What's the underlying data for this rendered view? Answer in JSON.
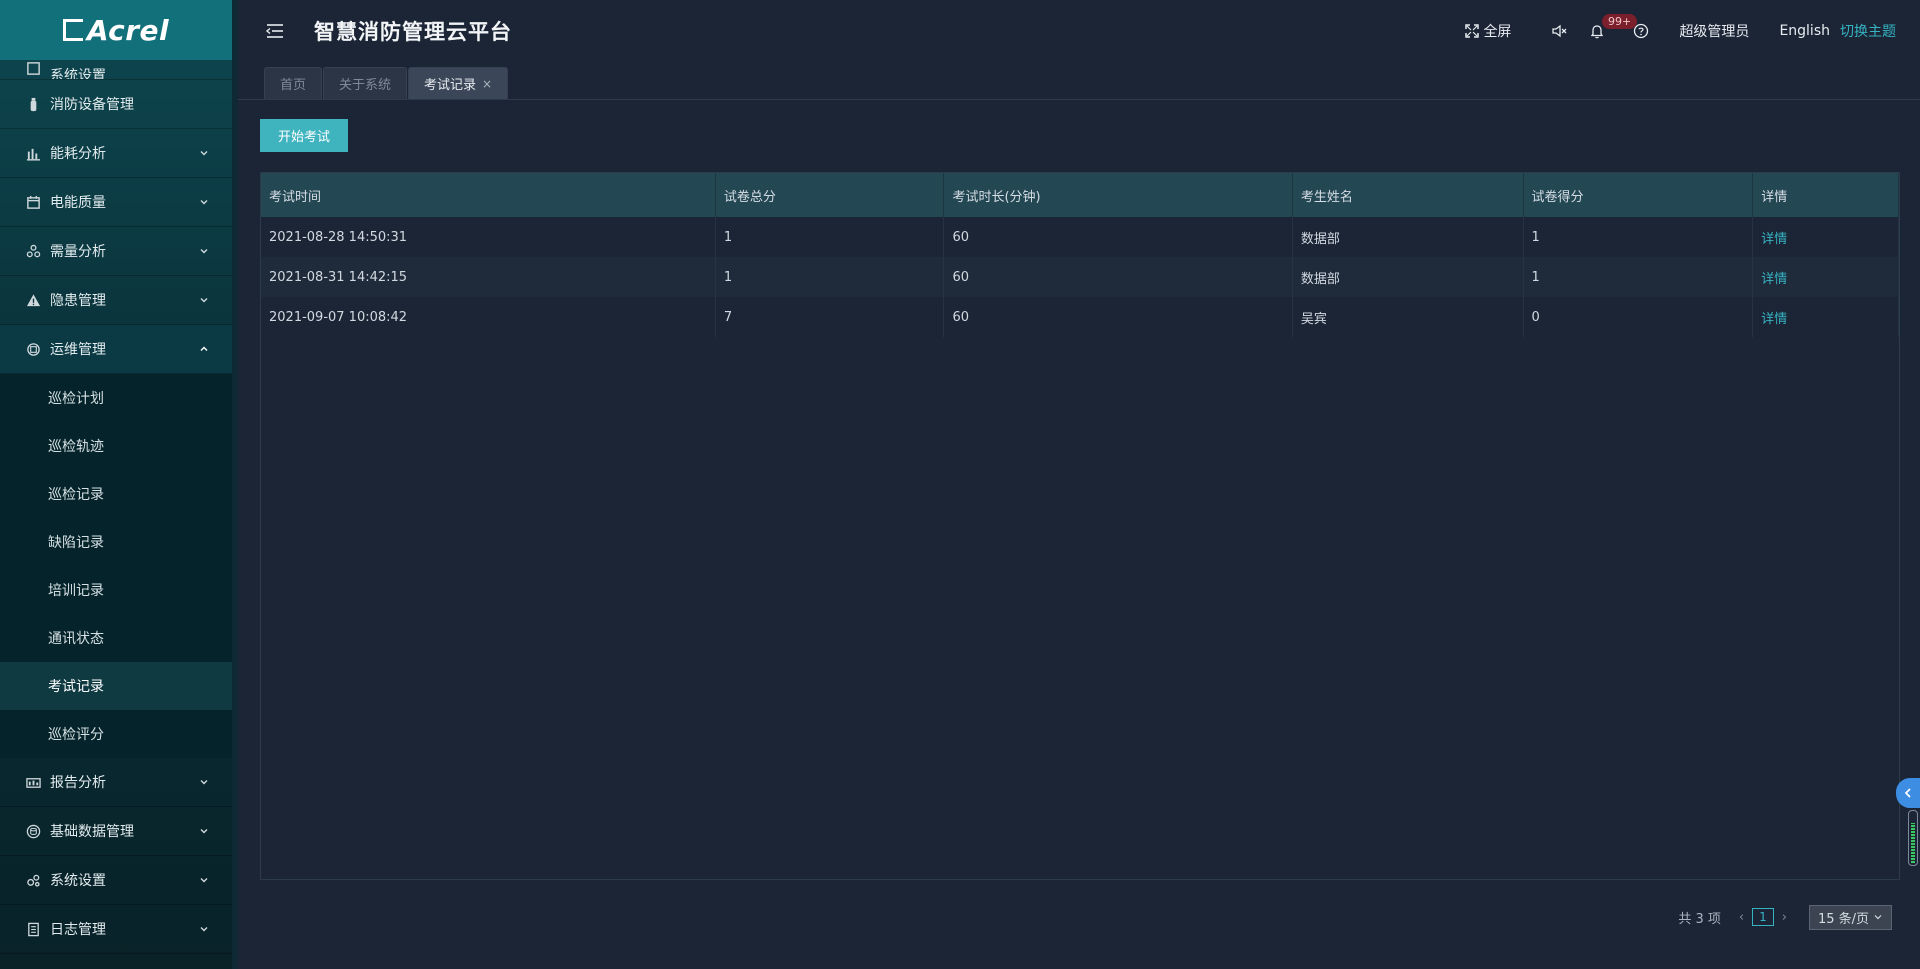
{
  "logo": {
    "text": "Acrel"
  },
  "sidebar": {
    "partial_label": "系统设置",
    "items": [
      {
        "label": "消防设备管理",
        "icon": "fire-extinguisher-icon",
        "chevron": false
      },
      {
        "label": "能耗分析",
        "icon": "bar-chart-icon",
        "chevron": true
      },
      {
        "label": "电能质量",
        "icon": "calendar-icon",
        "chevron": true
      },
      {
        "label": "需量分析",
        "icon": "nodes-icon",
        "chevron": true
      },
      {
        "label": "隐患管理",
        "icon": "warning-icon",
        "chevron": true
      },
      {
        "label": "运维管理",
        "icon": "maintenance-icon",
        "chevron": true,
        "open": true
      }
    ],
    "submenu": [
      {
        "label": "巡检计划"
      },
      {
        "label": "巡检轨迹"
      },
      {
        "label": "巡检记录"
      },
      {
        "label": "缺陷记录"
      },
      {
        "label": "培训记录"
      },
      {
        "label": "通讯状态"
      },
      {
        "label": "考试记录",
        "active": true
      },
      {
        "label": "巡检评分"
      }
    ],
    "items_after": [
      {
        "label": "报告分析",
        "icon": "report-icon"
      },
      {
        "label": "基础数据管理",
        "icon": "database-icon"
      },
      {
        "label": "系统设置",
        "icon": "settings-nodes-icon"
      },
      {
        "label": "日志管理",
        "icon": "log-icon"
      }
    ]
  },
  "header": {
    "title": "智慧消防管理云平台",
    "fullscreen_label": "全屏",
    "badge": "99+",
    "user": "超级管理员",
    "language": "English",
    "theme_switch": "切换主题"
  },
  "tabs": [
    {
      "label": "首页",
      "active": false
    },
    {
      "label": "关于系统",
      "active": false
    },
    {
      "label": "考试记录",
      "active": true,
      "closable": true
    }
  ],
  "toolbar": {
    "start_exam": "开始考试"
  },
  "table": {
    "columns": [
      "考试时间",
      "试卷总分",
      "考试时长(分钟)",
      "考生姓名",
      "试卷得分",
      "详情"
    ],
    "rows": [
      {
        "time": "2021-08-28 14:50:31",
        "total": "1",
        "duration": "60",
        "name": "数据部",
        "score": "1",
        "detail": "详情"
      },
      {
        "time": "2021-08-31 14:42:15",
        "total": "1",
        "duration": "60",
        "name": "数据部",
        "score": "1",
        "detail": "详情"
      },
      {
        "time": "2021-09-07 10:08:42",
        "total": "7",
        "duration": "60",
        "name": "吴宾",
        "score": "0",
        "detail": "详情"
      }
    ]
  },
  "pagination": {
    "total_text": "共 3 项",
    "current_page": "1",
    "page_size": "15 条/页"
  },
  "colors": {
    "accent": "#36b3c2",
    "button": "#3fb4bf",
    "background": "#1b2536",
    "sidebar_top": "#0e4750"
  }
}
